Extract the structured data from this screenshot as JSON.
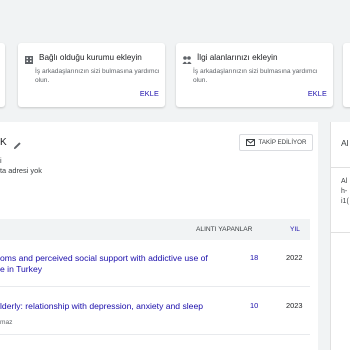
{
  "cards": [
    {
      "title": "Bağlı olduğu kurumu ekleyin",
      "desc": "İş arkadaşlarınızın sizi bulmasına yardımcı olun.",
      "action": "EKLE",
      "icon": "building-icon"
    },
    {
      "title": "İlgi alanlarınızı ekleyin",
      "desc": "İş arkadaşlarınızın sizi bulmasına yardımcı olun.",
      "action": "EKLE",
      "icon": "people-icon"
    }
  ],
  "profile": {
    "name_fragment": "K",
    "info_line1": "i",
    "info_line2": "ta adresi yok",
    "follow_label": "TAKİP EDİLİYOR"
  },
  "side": {
    "heading": "Al",
    "line1": "Al",
    "line2": "h-",
    "line3": "i1("
  },
  "table": {
    "col_cited": "ALINTI YAPANLAR",
    "col_year": "YIL",
    "rows": [
      {
        "title_line1": "oms and perceived social support with addictive use of",
        "title_line2": "e in Turkey",
        "cited": "18",
        "year": "2022"
      },
      {
        "title_line1": "lderly: relationship with depression, anxiety and sleep",
        "title_line2": "maz",
        "cited": "10",
        "year": "2023"
      }
    ]
  },
  "colors": {
    "link": "#1a0dab",
    "background": "#f1f3f4"
  }
}
